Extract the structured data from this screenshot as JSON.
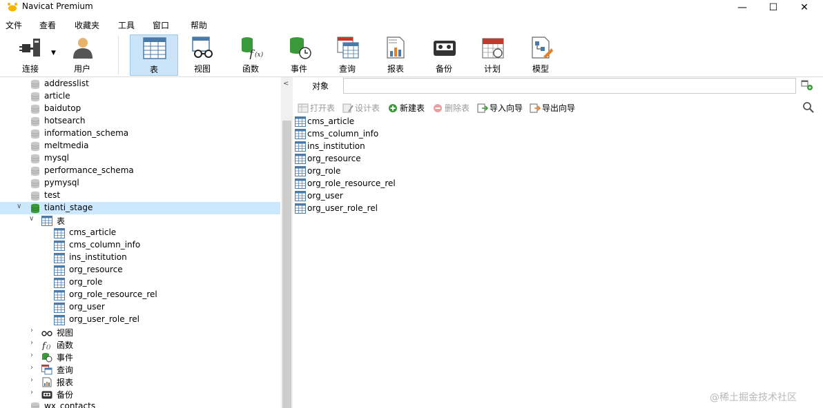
{
  "window": {
    "title": "Navicat Premium",
    "controls": {
      "minimize": "—",
      "maximize": "☐",
      "close": "✕"
    }
  },
  "menu": [
    "文件",
    "查看",
    "收藏夹",
    "工具",
    "窗口",
    "帮助"
  ],
  "toolbar": {
    "connect": "连接",
    "user": "用户",
    "table": "表",
    "view": "视图",
    "function": "函数",
    "event": "事件",
    "query": "查询",
    "report": "报表",
    "backup": "备份",
    "schedule": "计划",
    "model": "模型",
    "active": "表"
  },
  "tree": {
    "databases_top": [
      "addresslist",
      "article",
      "baidutop",
      "hotsearch",
      "information_schema",
      "meltmedia",
      "mysql",
      "performance_schema",
      "pymysql",
      "test"
    ],
    "open_db": "tianti_stage",
    "tables_group": "表",
    "tables": [
      "cms_article",
      "cms_column_info",
      "ins_institution",
      "org_resource",
      "org_role",
      "org_role_resource_rel",
      "org_user",
      "org_user_role_rel"
    ],
    "groups": [
      "视图",
      "函数",
      "事件",
      "查询",
      "报表",
      "备份"
    ],
    "databases_bottom": [
      "wx_contacts"
    ]
  },
  "object_tab": {
    "label": "对象"
  },
  "object_toolbar": {
    "open": "打开表",
    "design": "设计表",
    "new": "新建表",
    "delete": "删除表",
    "import": "导入向导",
    "export": "导出向导"
  },
  "object_list": [
    "cms_article",
    "cms_column_info",
    "ins_institution",
    "org_resource",
    "org_role",
    "org_role_resource_rel",
    "org_user",
    "org_user_role_rel"
  ],
  "watermark": "@稀土掘金技术社区"
}
